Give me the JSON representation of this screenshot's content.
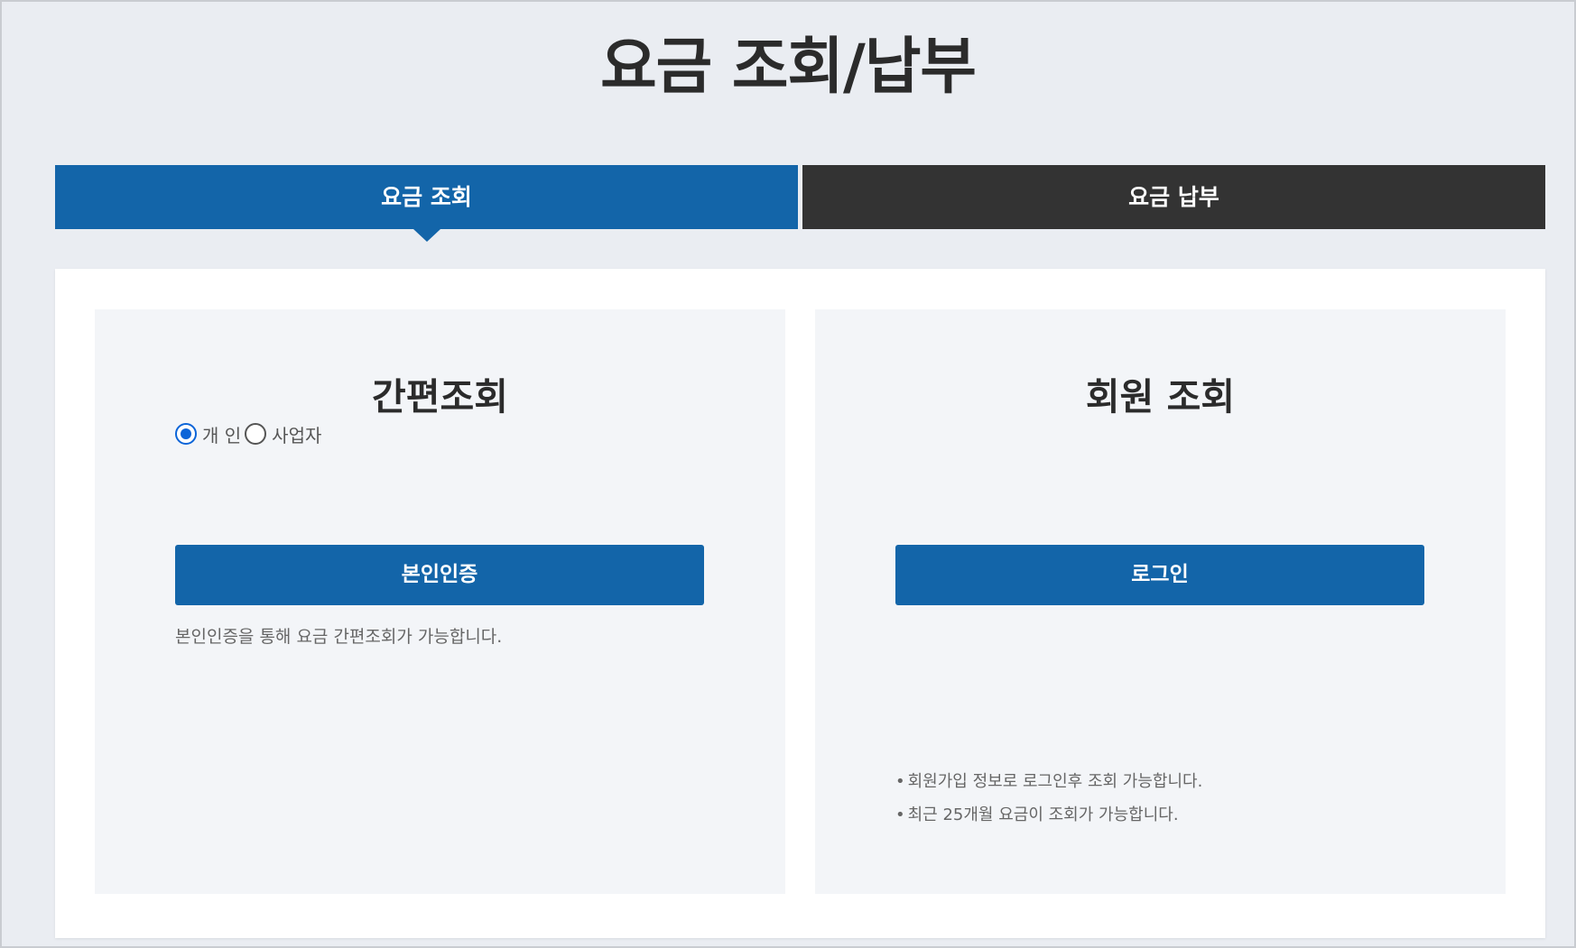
{
  "page": {
    "title": "요금 조회/납부"
  },
  "tabs": [
    {
      "label": "요금 조회",
      "active": true
    },
    {
      "label": "요금 납부",
      "active": false
    }
  ],
  "simple_lookup": {
    "title": "간편조회",
    "radios": [
      {
        "label": "개 인",
        "checked": true
      },
      {
        "label": "사업자",
        "checked": false
      }
    ],
    "button_label": "본인인증",
    "helper": "본인인증을 통해 요금 간편조회가 가능합니다."
  },
  "member_lookup": {
    "title": "회원 조회",
    "button_label": "로그인",
    "notes": [
      "회원가입 정보로 로그인후 조회 가능합니다.",
      "최근 25개월 요금이 조회가 가능합니다."
    ]
  },
  "colors": {
    "primary": "#1365a9",
    "tab_inactive": "#333333",
    "background": "#eaedf2",
    "card": "#f3f5f8",
    "radio_accent": "#0a64d8"
  }
}
